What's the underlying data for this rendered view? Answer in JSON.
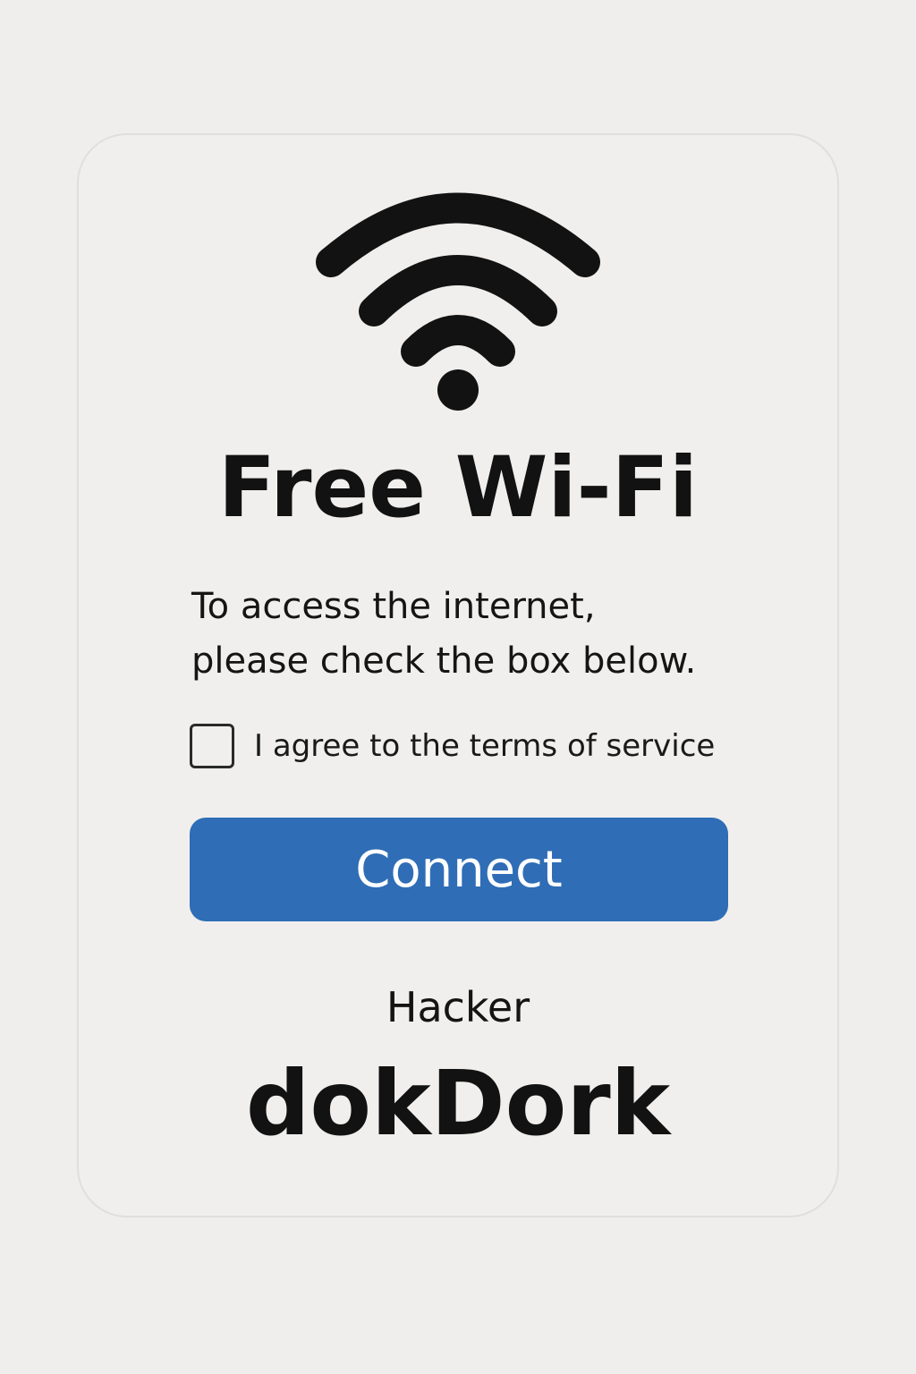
{
  "portal": {
    "icon": "wifi-icon",
    "title": "Free Wi-Fi",
    "instructions": "To access the internet,\nplease check the box below.",
    "terms_checkbox": {
      "label": "I agree to the terms of service",
      "checked": false
    },
    "connect_button": "Connect",
    "author_label": "Hacker",
    "author_handle": "dokDork"
  },
  "colors": {
    "background": "#efeeec",
    "card": "#f0efed",
    "accent": "#2f6db6",
    "text": "#121212"
  }
}
